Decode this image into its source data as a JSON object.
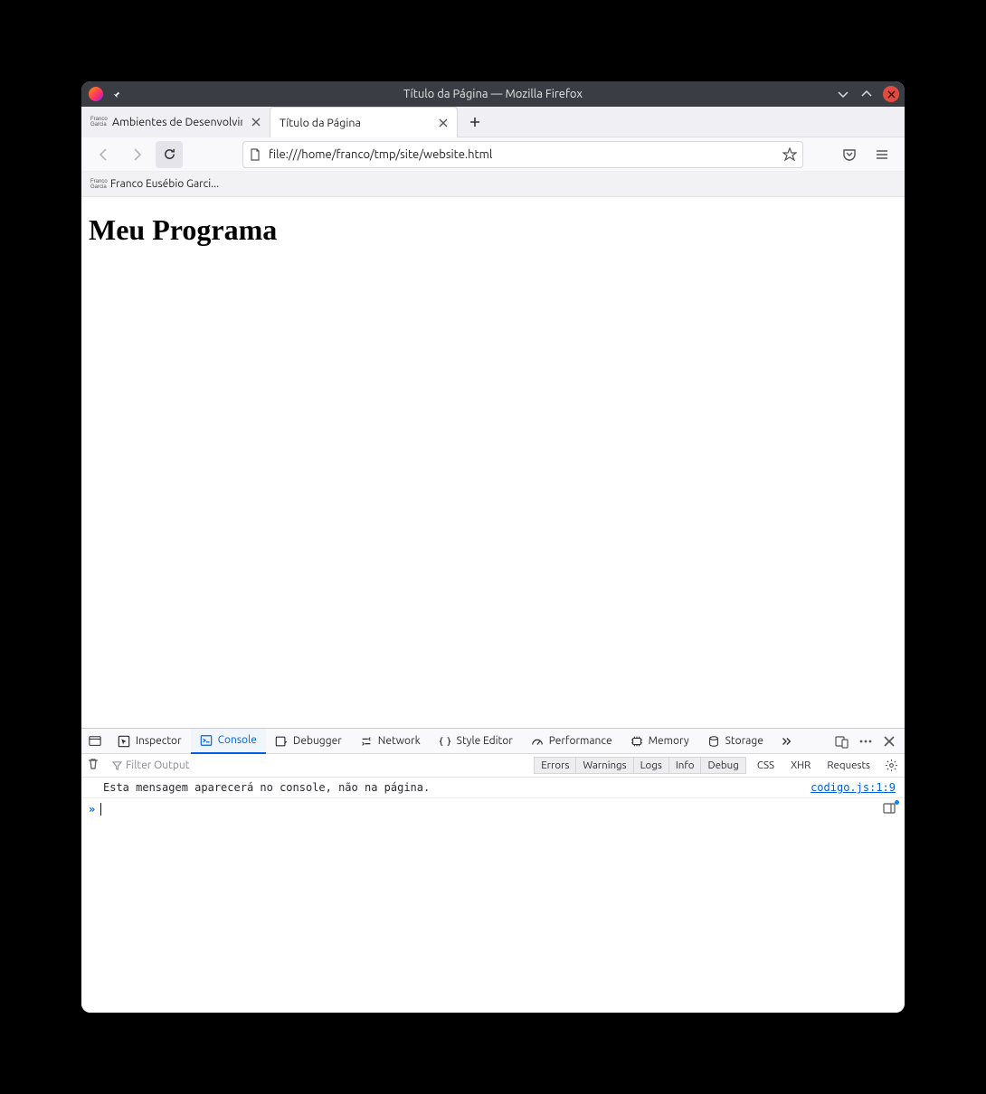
{
  "titlebar": {
    "title": "Título da Página — Mozilla Firefox"
  },
  "tabs": [
    {
      "label": "Ambientes de Desenvolvimen",
      "favicon_top": "Franco",
      "favicon_bottom": "Garcia",
      "active": false
    },
    {
      "label": "Título da Página",
      "active": true
    }
  ],
  "navbar": {
    "url": "file:///home/franco/tmp/site/website.html"
  },
  "bookmarks": [
    {
      "label": "Franco Eusébio Garci...",
      "favicon_top": "Franco",
      "favicon_bottom": "Garcia"
    }
  ],
  "page": {
    "heading": "Meu Programa"
  },
  "devtools": {
    "tabs": {
      "inspector": "Inspector",
      "console": "Console",
      "debugger": "Debugger",
      "network": "Network",
      "style_editor": "Style Editor",
      "performance": "Performance",
      "memory": "Memory",
      "storage": "Storage"
    },
    "filters": {
      "placeholder": "Filter Output",
      "errors": "Errors",
      "warnings": "Warnings",
      "logs": "Logs",
      "info": "Info",
      "debug": "Debug",
      "css": "CSS",
      "xhr": "XHR",
      "requests": "Requests"
    },
    "log": {
      "message": "Esta mensagem aparecerá no console, não na página.",
      "source": "codigo.js:1:9"
    }
  }
}
